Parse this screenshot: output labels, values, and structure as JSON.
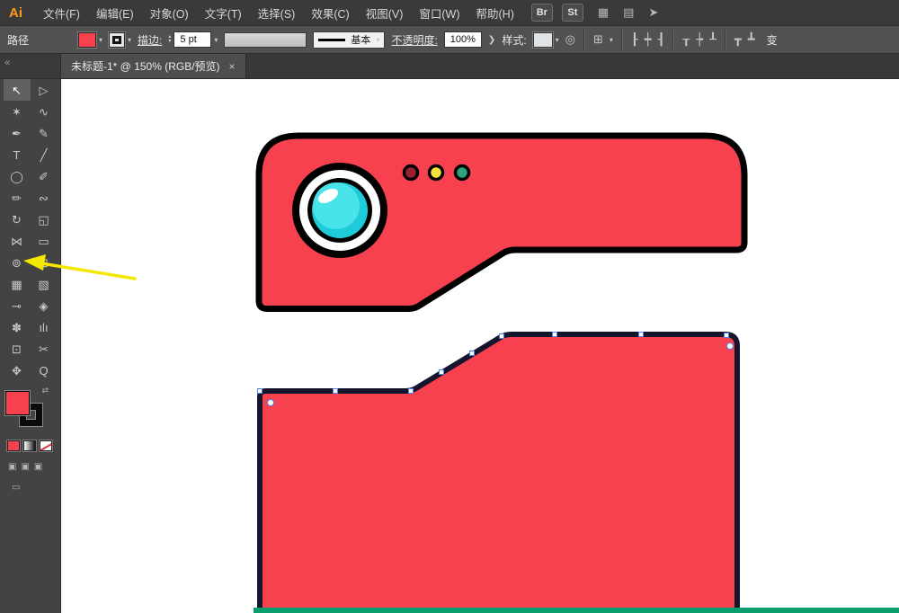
{
  "menubar": {
    "logo": "Ai",
    "items": [
      "文件(F)",
      "编辑(E)",
      "对象(O)",
      "文字(T)",
      "选择(S)",
      "效果(C)",
      "视图(V)",
      "窗口(W)",
      "帮助(H)"
    ],
    "badges": [
      "Br",
      "St"
    ],
    "icons": {
      "arrange": "▦",
      "workspace": "▤",
      "share": "➤"
    }
  },
  "controlbar": {
    "selection_label": "路径",
    "stroke_label": "描边:",
    "stroke_weight": "5 pt",
    "brush_definition": "基本",
    "opacity_label": "不透明度:",
    "opacity_value": "100%",
    "style_label": "样式:",
    "transform_label": "变",
    "misc_icon": "◎",
    "setup_icon": "⊞",
    "align_icons": [
      "┠",
      "┿",
      "┨"
    ],
    "distribute_icons": [
      "┰",
      "┾",
      "┸"
    ],
    "vertical_icons": [
      "┳",
      "┻"
    ]
  },
  "icons": {
    "caret": "▾",
    "up": "▴",
    "down": "▾",
    "chevron": "❯",
    "collapse": "«",
    "swap": "⇄",
    "close": "×",
    "mode": "▣",
    "screen": "▭"
  },
  "tab": {
    "title": "未标题-1* @ 150% (RGB/预览)"
  },
  "toolbar": {
    "tools": [
      {
        "name": "selection-tool",
        "glyph": "↖",
        "selected": true
      },
      {
        "name": "direct-selection-tool",
        "glyph": "▷"
      },
      {
        "name": "magic-wand-tool",
        "glyph": "✶"
      },
      {
        "name": "lasso-tool",
        "glyph": "∿"
      },
      {
        "name": "pen-tool",
        "glyph": "✒"
      },
      {
        "name": "curvature-tool",
        "glyph": "✎"
      },
      {
        "name": "type-tool",
        "glyph": "T"
      },
      {
        "name": "line-segment-tool",
        "glyph": "╱"
      },
      {
        "name": "ellipse-tool",
        "glyph": "◯"
      },
      {
        "name": "paintbrush-tool",
        "glyph": "✐"
      },
      {
        "name": "pencil-tool",
        "glyph": "✏"
      },
      {
        "name": "shaper-tool",
        "glyph": "∾"
      },
      {
        "name": "rotate-tool",
        "glyph": "↻"
      },
      {
        "name": "scale-tool",
        "glyph": "◱"
      },
      {
        "name": "width-tool",
        "glyph": "⋈"
      },
      {
        "name": "free-transform-tool",
        "glyph": "▭"
      },
      {
        "name": "shape-builder-tool",
        "glyph": "⊚"
      },
      {
        "name": "perspective-grid-tool",
        "glyph": "⊞"
      },
      {
        "name": "mesh-tool",
        "glyph": "▦"
      },
      {
        "name": "gradient-tool",
        "glyph": "▧"
      },
      {
        "name": "eyedropper-tool",
        "glyph": "⊸"
      },
      {
        "name": "blend-tool",
        "glyph": "◈"
      },
      {
        "name": "symbol-sprayer-tool",
        "glyph": "✽"
      },
      {
        "name": "column-graph-tool",
        "glyph": "ılı"
      },
      {
        "name": "artboard-tool",
        "glyph": "⊡"
      },
      {
        "name": "slice-tool",
        "glyph": "✂"
      },
      {
        "name": "hand-tool",
        "glyph": "✥"
      },
      {
        "name": "zoom-tool",
        "glyph": "Q"
      }
    ]
  },
  "color_widget": {
    "fill": "#F8414F",
    "stroke": "#000000"
  },
  "artwork": {
    "fill_red": "#F8414F",
    "outline_black": "#000000",
    "lens_cyan": "#1ECBD8",
    "lens_cyan_light": "#49E4EA",
    "indicator_colors": [
      "#9B2030",
      "#F4E43C",
      "#2FA077"
    ],
    "bottom_stroke": "#15152E",
    "anchor_blue": "#4F82E0",
    "green_bar": "#0A9E6E",
    "arrow_yellow": "#F4E800"
  }
}
